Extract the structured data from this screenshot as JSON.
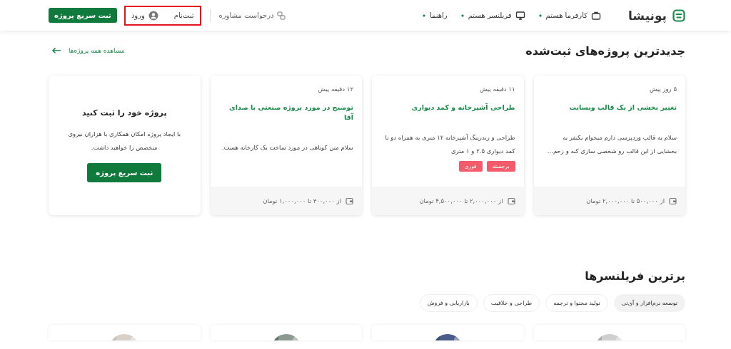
{
  "header": {
    "logo": "پونیشا",
    "nav": [
      {
        "label": "کارفرما هستم"
      },
      {
        "label": "فریلنسر هستم"
      },
      {
        "label": "راهنما"
      }
    ],
    "consult": "درخواست مشاوره",
    "auth": {
      "register": "ثبت‌نام",
      "login": "ورود",
      "highlighted": true
    },
    "cta": "ثبت سریع پروژه"
  },
  "projects": {
    "title": "جدیدترین پروژه‌های ثبت‌شده",
    "view_all": "مشاهده همه پروژه‌ها",
    "cards": [
      {
        "time": "۵ روز پیش",
        "title": "تغییر بخشی از یک قالب وبسایت",
        "description": "سلام به قالب وردپرسی دارم میخوام یکنفر به بخشایی از این قالب رو شخصی سازی کنه و زحم...",
        "budget": "از ۵۰۰,۰۰۰ تا ۲,۰۰۰,۰۰۰ تومان"
      },
      {
        "time": "۱۱ دقیقه پیش",
        "title": "طراحی آشپزخانه و کمد دیواری",
        "description": "طراحی و رندرینگ آشپزخانه ۱۲ متری به همراه دو تا کمد دیواری ۲.۵ و ۱ متری",
        "tags": [
          "برجسته",
          "فوری"
        ],
        "budget": "از ۲,۰۰۰,۰۰۰ تا ۴,۵۰۰,۰۰۰ تومان"
      },
      {
        "time": "۱۲ دقیقه پیش",
        "title": "توضیح در مورد پروژه صنعتی با صدای آقا",
        "description": "سلام متن کوتاهی در مورد ساخت یک کارخانه هست.",
        "budget": "از ۳۰۰,۰۰۰ تا ۱,۰۰۰,۰۰۰ تومان"
      }
    ],
    "promo": {
      "title": "پروژه خود را ثبت کنید",
      "text": "با ایجاد پروژه امکان همکاری با هزاران نیروی متخصص را خواهید داشت.",
      "button": "ثبت سریع پروژه"
    }
  },
  "freelancers": {
    "title": "برترین فریلنسرها",
    "categories": [
      {
        "label": "توسعه نرم‌افزار و آی‌تی",
        "selected": true
      },
      {
        "label": "تولید محتوا و ترجمه",
        "selected": false
      },
      {
        "label": "طراحی و خلاقیت",
        "selected": false
      },
      {
        "label": "بازاریابی و فروش",
        "selected": false
      }
    ]
  }
}
